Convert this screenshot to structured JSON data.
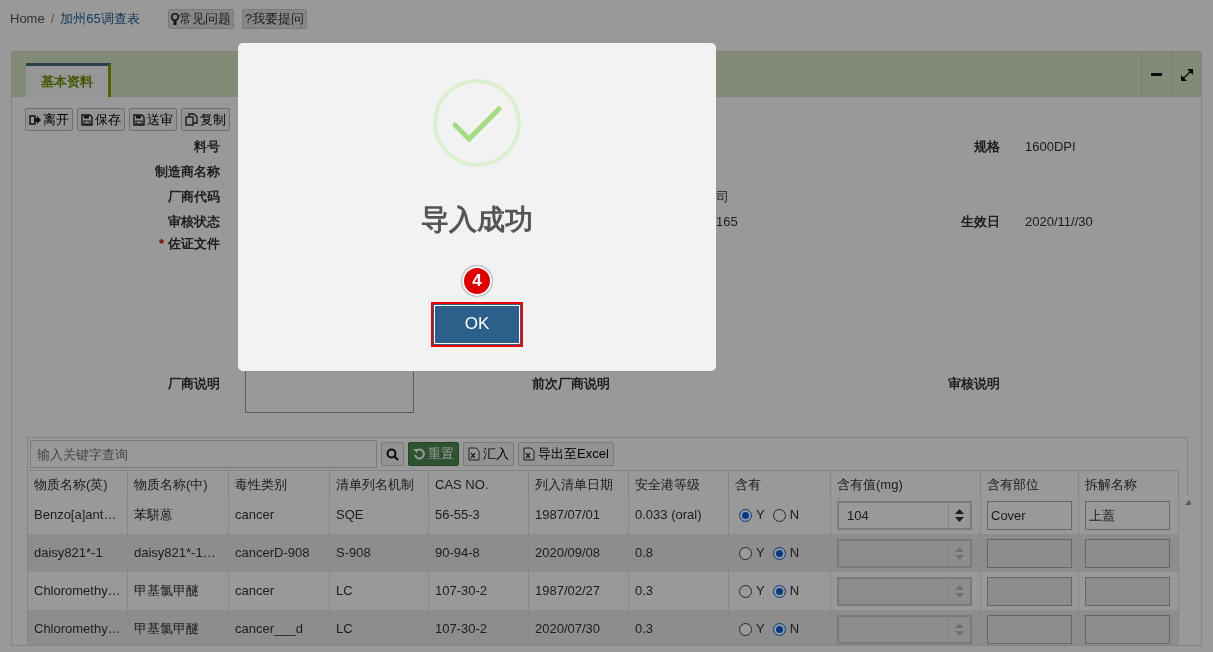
{
  "breadcrumb": [
    {
      "label": "Home",
      "selected": false
    },
    {
      "separator": "/",
      "label": "加州65调查表",
      "selected": true
    }
  ],
  "help_buttons": [
    {
      "label": "常见问题",
      "kind": "tip"
    },
    {
      "label": "?我要提问",
      "kind": "ask"
    }
  ],
  "tabs": [
    {
      "label": "基本资料",
      "selected": true
    }
  ],
  "toolbar": [
    {
      "label": "离开",
      "kind": "exit"
    },
    {
      "label": "保存",
      "kind": "save"
    },
    {
      "label": "送审",
      "kind": "save"
    },
    {
      "label": "复制",
      "kind": "copy"
    }
  ],
  "form": {
    "rows": [
      {
        "label": "料号",
        "right_label": "规格",
        "right_value": "1600DPI"
      },
      {
        "label": "制造商名称"
      },
      {
        "label": "厂商代码",
        "middle_value": "司"
      },
      {
        "label": "审核状态",
        "middle_value": "165",
        "right_label": "生效日",
        "right_value": "2020/11//30"
      }
    ],
    "evidence": {
      "label": "佐证文件",
      "required_mark": "*"
    },
    "notes": {
      "label": "厂商说明",
      "middle_label": "前次厂商说明",
      "right_label": "审核说明"
    }
  },
  "substances": {
    "search": {
      "placeholder": "输入关键字查询"
    },
    "buttons": [
      {
        "label": "重置",
        "kind": "reset"
      },
      {
        "label": "汇入",
        "kind": "import"
      },
      {
        "label": "导出至Excel",
        "kind": "export"
      }
    ],
    "columns": [
      "物质名称(英)",
      "物质名称(中)",
      "毒性类别",
      "清单列名机制",
      "CAS NO.",
      "列入清单日期",
      "安全港等级",
      "含有",
      "含有值(mg)",
      "含有部位",
      "拆解名称"
    ],
    "rows": [
      {
        "cells": [
          "Benzo[a]ant…",
          "苯駢蒽",
          "cancer",
          "SQE",
          "56-55-3",
          "1987/07/01",
          "0.033 (oral)"
        ],
        "options": [
          {
            "label": "Y",
            "selected": true
          },
          {
            "label": "N",
            "selected": false
          }
        ],
        "amount": {
          "value": "104",
          "disabled": false
        },
        "part": {
          "value": "Cover",
          "disabled": false
        },
        "dismantle": {
          "value": "上蓋",
          "disabled": false
        }
      },
      {
        "cells": [
          "daisy821*-1",
          "daisy821*-1…",
          "cancerD-908",
          "S-908",
          "90-94-8",
          "2020/09/08",
          "0.8"
        ],
        "options": [
          {
            "label": "Y",
            "selected": false
          },
          {
            "label": "N",
            "selected": true
          }
        ],
        "amount": {
          "disabled": true
        },
        "part": {
          "disabled": true
        },
        "dismantle": {
          "disabled": true
        }
      },
      {
        "cells": [
          "Chloromethy…",
          "甲基氯甲醚",
          "cancer",
          "LC",
          "107-30-2",
          "1987/02/27",
          "0.3"
        ],
        "options": [
          {
            "label": "Y",
            "selected": false
          },
          {
            "label": "N",
            "selected": true
          }
        ],
        "amount": {
          "disabled": true
        },
        "part": {
          "disabled": true
        },
        "dismantle": {
          "disabled": true
        }
      },
      {
        "cells": [
          "Chloromethy…",
          "甲基氯甲醚",
          "cancer___d",
          "LC",
          "107-30-2",
          "2020/07/30",
          "0.3"
        ],
        "options": [
          {
            "label": "Y",
            "selected": false
          },
          {
            "label": "N",
            "selected": true
          }
        ],
        "amount": {
          "disabled": true
        },
        "part": {
          "disabled": true
        },
        "dismantle": {
          "disabled": true
        }
      }
    ]
  },
  "dialog": {
    "title": "导入成功",
    "step": "4",
    "button": "OK"
  }
}
